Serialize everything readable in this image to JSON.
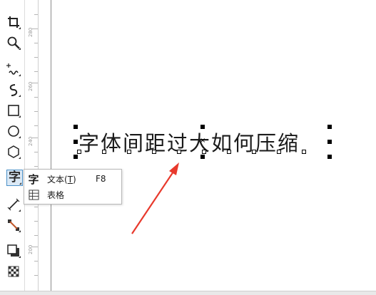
{
  "toolbox": {
    "tools": [
      {
        "name": "crop-icon"
      },
      {
        "name": "zoom-icon"
      },
      {
        "name": "freehand-icon"
      },
      {
        "name": "artistic-media-icon"
      },
      {
        "name": "rectangle-icon"
      },
      {
        "name": "ellipse-icon"
      },
      {
        "name": "polygon-icon"
      },
      {
        "name": "text-tool-icon",
        "glyph": "字",
        "active": true
      },
      {
        "name": "parallel-dimension-icon"
      },
      {
        "name": "connector-icon"
      },
      {
        "name": "drop-shadow-icon"
      },
      {
        "name": "transparency-icon"
      }
    ]
  },
  "ruler": {
    "labels": [
      "280",
      "260",
      "240",
      "200"
    ]
  },
  "canvas": {
    "text": "字体间距过大如何压缩"
  },
  "flyout": {
    "items": [
      {
        "icon_glyph": "字",
        "label": "文本(T)",
        "label_main": "文本(",
        "label_underline": "T",
        "label_end": ")",
        "shortcut": "F8"
      },
      {
        "icon": "table-icon",
        "label": "表格"
      }
    ]
  },
  "annotation": {
    "arrow_color": "#e8392c"
  }
}
